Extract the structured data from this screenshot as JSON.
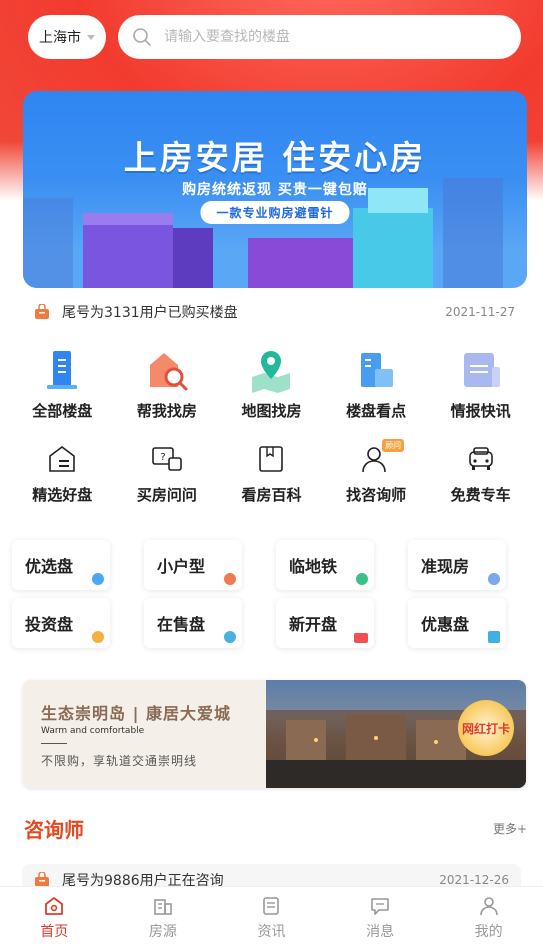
{
  "header": {
    "city": "上海市",
    "search_placeholder": "请输入要查找的楼盘"
  },
  "banner": {
    "title": "上房安居 住安心房",
    "subtitle": "购房统统返现 买贵一键包赔",
    "pill": "一款专业购房避雷针"
  },
  "notice": {
    "text": "尾号为3131用户已购买楼盘",
    "date": "2021-11-27"
  },
  "grid": [
    {
      "label": "全部楼盘",
      "icon": "building-icon"
    },
    {
      "label": "帮我找房",
      "icon": "house-search-icon"
    },
    {
      "label": "地图找房",
      "icon": "map-pin-icon"
    },
    {
      "label": "楼盘看点",
      "icon": "buildings-icon"
    },
    {
      "label": "情报快讯",
      "icon": "news-icon"
    },
    {
      "label": "精选好盘",
      "icon": "house-outline-icon"
    },
    {
      "label": "买房问问",
      "icon": "question-chat-icon"
    },
    {
      "label": "看房百科",
      "icon": "book-icon"
    },
    {
      "label": "找咨询师",
      "icon": "consultant-icon"
    },
    {
      "label": "免费专车",
      "icon": "car-icon"
    }
  ],
  "consultant_badge": "顾问",
  "tags": [
    {
      "label": "优选盘",
      "color": "#4aa8f0"
    },
    {
      "label": "小户型",
      "color": "#f07a50"
    },
    {
      "label": "临地铁",
      "color": "#3cc08a"
    },
    {
      "label": "准现房",
      "color": "#7aa8e8"
    },
    {
      "label": "投资盘",
      "color": "#f5b040"
    },
    {
      "label": "在售盘",
      "color": "#4ab0e0"
    },
    {
      "label": "新开盘",
      "color": "#f05050"
    },
    {
      "label": "优惠盘",
      "color": "#40b0e0"
    }
  ],
  "ad": {
    "title": "生态崇明岛 | 康居大爱城",
    "en": "Warm and comfortable",
    "sub": "不限购，享轨道交通崇明线",
    "badge": "网红打卡"
  },
  "section": {
    "title": "咨询师",
    "more": "更多+"
  },
  "notice2": {
    "text": "尾号为9886用户正在咨询",
    "date": "2021-12-26"
  },
  "tabbar": [
    {
      "label": "首页",
      "icon": "home-icon"
    },
    {
      "label": "房源",
      "icon": "listing-icon"
    },
    {
      "label": "资讯",
      "icon": "article-icon"
    },
    {
      "label": "消息",
      "icon": "message-icon"
    },
    {
      "label": "我的",
      "icon": "profile-icon"
    }
  ],
  "colors": {
    "accent": "#e23a2c",
    "section_title": "#e8471e",
    "banner_blue": "#2f86f0"
  }
}
